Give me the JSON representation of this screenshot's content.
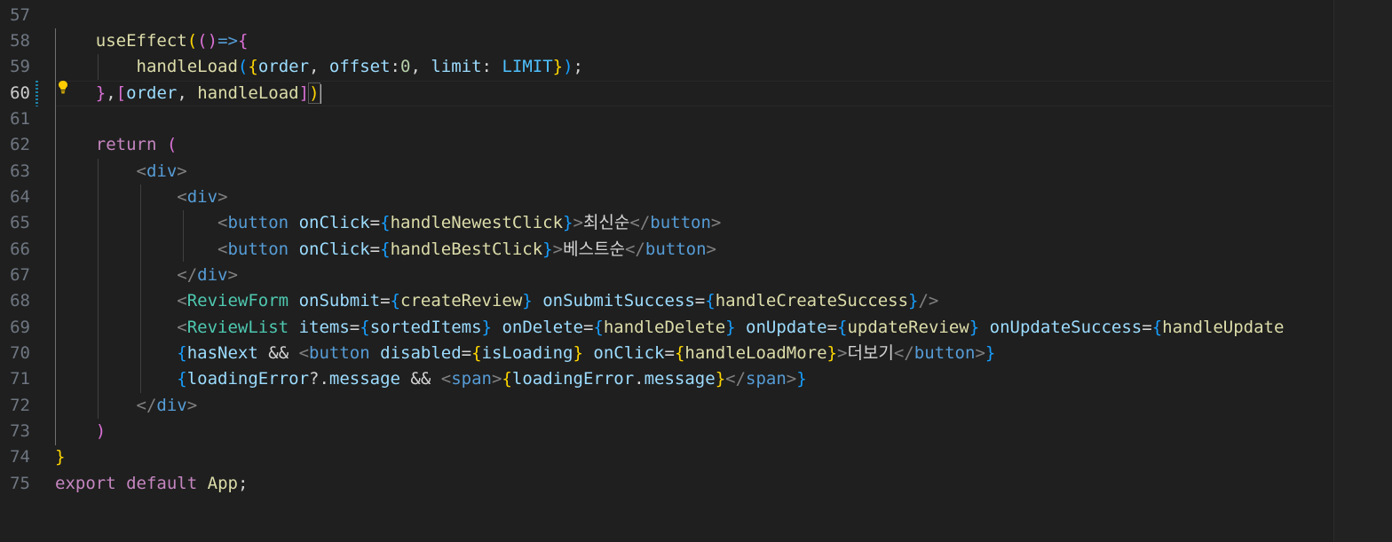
{
  "editor": {
    "active_line": "60",
    "line_numbers": [
      "57",
      "58",
      "59",
      "60",
      "61",
      "62",
      "63",
      "64",
      "65",
      "66",
      "67",
      "68",
      "69",
      "70",
      "71",
      "72",
      "73",
      "74",
      "75"
    ],
    "lines": {
      "l57": [],
      "l58": [
        {
          "t": "    ",
          "c": "txt"
        },
        {
          "t": "useEffect",
          "c": "fn"
        },
        {
          "t": "(",
          "c": "b1"
        },
        {
          "t": "()",
          "c": "b2"
        },
        {
          "t": "=>",
          "c": "tag"
        },
        {
          "t": "{",
          "c": "b2"
        }
      ],
      "l59": [
        {
          "t": "        ",
          "c": "txt"
        },
        {
          "t": "handleLoad",
          "c": "fn"
        },
        {
          "t": "(",
          "c": "b3"
        },
        {
          "t": "{",
          "c": "b1"
        },
        {
          "t": "order",
          "c": "var"
        },
        {
          "t": ", ",
          "c": "txt"
        },
        {
          "t": "offset",
          "c": "var"
        },
        {
          "t": ":",
          "c": "txt"
        },
        {
          "t": "0",
          "c": "num"
        },
        {
          "t": ", ",
          "c": "txt"
        },
        {
          "t": "limit",
          "c": "var"
        },
        {
          "t": ": ",
          "c": "txt"
        },
        {
          "t": "LIMIT",
          "c": "cst"
        },
        {
          "t": "}",
          "c": "b1"
        },
        {
          "t": ")",
          "c": "b3"
        },
        {
          "t": ";",
          "c": "txt"
        }
      ],
      "l60": [
        {
          "t": "    ",
          "c": "txt"
        },
        {
          "t": "}",
          "c": "b2"
        },
        {
          "t": ",",
          "c": "txt"
        },
        {
          "t": "[",
          "c": "b2"
        },
        {
          "t": "order",
          "c": "var"
        },
        {
          "t": ", ",
          "c": "txt"
        },
        {
          "t": "handleLoad",
          "c": "fn"
        },
        {
          "t": "]",
          "c": "b2"
        },
        {
          "t": ")",
          "c": "b1 mb"
        }
      ],
      "l61": [],
      "l62": [
        {
          "t": "    ",
          "c": "txt"
        },
        {
          "t": "return",
          "c": "kw"
        },
        {
          "t": " ",
          "c": "txt"
        },
        {
          "t": "(",
          "c": "b2"
        }
      ],
      "l63": [
        {
          "t": "        ",
          "c": "txt"
        },
        {
          "t": "<",
          "c": "ang"
        },
        {
          "t": "div",
          "c": "tag"
        },
        {
          "t": ">",
          "c": "ang"
        }
      ],
      "l64": [
        {
          "t": "            ",
          "c": "txt"
        },
        {
          "t": "<",
          "c": "ang"
        },
        {
          "t": "div",
          "c": "tag"
        },
        {
          "t": ">",
          "c": "ang"
        }
      ],
      "l65": [
        {
          "t": "                ",
          "c": "txt"
        },
        {
          "t": "<",
          "c": "ang"
        },
        {
          "t": "button",
          "c": "tag"
        },
        {
          "t": " ",
          "c": "txt"
        },
        {
          "t": "onClick",
          "c": "var"
        },
        {
          "t": "=",
          "c": "txt"
        },
        {
          "t": "{",
          "c": "b3"
        },
        {
          "t": "handleNewestClick",
          "c": "fn"
        },
        {
          "t": "}",
          "c": "b3"
        },
        {
          "t": ">",
          "c": "ang"
        },
        {
          "t": "최신순",
          "c": "txt"
        },
        {
          "t": "</",
          "c": "ang"
        },
        {
          "t": "button",
          "c": "tag"
        },
        {
          "t": ">",
          "c": "ang"
        }
      ],
      "l66": [
        {
          "t": "                ",
          "c": "txt"
        },
        {
          "t": "<",
          "c": "ang"
        },
        {
          "t": "button",
          "c": "tag"
        },
        {
          "t": " ",
          "c": "txt"
        },
        {
          "t": "onClick",
          "c": "var"
        },
        {
          "t": "=",
          "c": "txt"
        },
        {
          "t": "{",
          "c": "b3"
        },
        {
          "t": "handleBestClick",
          "c": "fn"
        },
        {
          "t": "}",
          "c": "b3"
        },
        {
          "t": ">",
          "c": "ang"
        },
        {
          "t": "베스트순",
          "c": "txt"
        },
        {
          "t": "</",
          "c": "ang"
        },
        {
          "t": "button",
          "c": "tag"
        },
        {
          "t": ">",
          "c": "ang"
        }
      ],
      "l67": [
        {
          "t": "            ",
          "c": "txt"
        },
        {
          "t": "</",
          "c": "ang"
        },
        {
          "t": "div",
          "c": "tag"
        },
        {
          "t": ">",
          "c": "ang"
        }
      ],
      "l68": [
        {
          "t": "            ",
          "c": "txt"
        },
        {
          "t": "<",
          "c": "ang"
        },
        {
          "t": "ReviewForm",
          "c": "cmp"
        },
        {
          "t": " ",
          "c": "txt"
        },
        {
          "t": "onSubmit",
          "c": "var"
        },
        {
          "t": "=",
          "c": "txt"
        },
        {
          "t": "{",
          "c": "b3"
        },
        {
          "t": "createReview",
          "c": "fn"
        },
        {
          "t": "}",
          "c": "b3"
        },
        {
          "t": " ",
          "c": "txt"
        },
        {
          "t": "onSubmitSuccess",
          "c": "var"
        },
        {
          "t": "=",
          "c": "txt"
        },
        {
          "t": "{",
          "c": "b3"
        },
        {
          "t": "handleCreateSuccess",
          "c": "fn"
        },
        {
          "t": "}",
          "c": "b3"
        },
        {
          "t": "/>",
          "c": "ang"
        }
      ],
      "l69": [
        {
          "t": "            ",
          "c": "txt"
        },
        {
          "t": "<",
          "c": "ang"
        },
        {
          "t": "ReviewList",
          "c": "cmp"
        },
        {
          "t": " ",
          "c": "txt"
        },
        {
          "t": "items",
          "c": "var"
        },
        {
          "t": "=",
          "c": "txt"
        },
        {
          "t": "{",
          "c": "b3"
        },
        {
          "t": "sortedItems",
          "c": "var"
        },
        {
          "t": "}",
          "c": "b3"
        },
        {
          "t": " ",
          "c": "txt"
        },
        {
          "t": "onDelete",
          "c": "var"
        },
        {
          "t": "=",
          "c": "txt"
        },
        {
          "t": "{",
          "c": "b3"
        },
        {
          "t": "handleDelete",
          "c": "fn"
        },
        {
          "t": "}",
          "c": "b3"
        },
        {
          "t": " ",
          "c": "txt"
        },
        {
          "t": "onUpdate",
          "c": "var"
        },
        {
          "t": "=",
          "c": "txt"
        },
        {
          "t": "{",
          "c": "b3"
        },
        {
          "t": "updateReview",
          "c": "fn"
        },
        {
          "t": "}",
          "c": "b3"
        },
        {
          "t": " ",
          "c": "txt"
        },
        {
          "t": "onUpdateSuccess",
          "c": "var"
        },
        {
          "t": "=",
          "c": "txt"
        },
        {
          "t": "{",
          "c": "b3"
        },
        {
          "t": "handleUpdate",
          "c": "fn"
        }
      ],
      "l70": [
        {
          "t": "            ",
          "c": "txt"
        },
        {
          "t": "{",
          "c": "b3"
        },
        {
          "t": "hasNext",
          "c": "var"
        },
        {
          "t": " && ",
          "c": "txt"
        },
        {
          "t": "<",
          "c": "ang"
        },
        {
          "t": "button",
          "c": "tag"
        },
        {
          "t": " ",
          "c": "txt"
        },
        {
          "t": "disabled",
          "c": "var"
        },
        {
          "t": "=",
          "c": "txt"
        },
        {
          "t": "{",
          "c": "b1"
        },
        {
          "t": "isLoading",
          "c": "var"
        },
        {
          "t": "}",
          "c": "b1"
        },
        {
          "t": " ",
          "c": "txt"
        },
        {
          "t": "onClick",
          "c": "var"
        },
        {
          "t": "=",
          "c": "txt"
        },
        {
          "t": "{",
          "c": "b1"
        },
        {
          "t": "handleLoadMore",
          "c": "fn"
        },
        {
          "t": "}",
          "c": "b1"
        },
        {
          "t": ">",
          "c": "ang"
        },
        {
          "t": "더보기",
          "c": "txt"
        },
        {
          "t": "</",
          "c": "ang"
        },
        {
          "t": "button",
          "c": "tag"
        },
        {
          "t": ">",
          "c": "ang"
        },
        {
          "t": "}",
          "c": "b3"
        }
      ],
      "l71": [
        {
          "t": "            ",
          "c": "txt"
        },
        {
          "t": "{",
          "c": "b3"
        },
        {
          "t": "loadingError",
          "c": "var"
        },
        {
          "t": "?.",
          "c": "txt"
        },
        {
          "t": "message",
          "c": "var"
        },
        {
          "t": " && ",
          "c": "txt"
        },
        {
          "t": "<",
          "c": "ang"
        },
        {
          "t": "span",
          "c": "tag"
        },
        {
          "t": ">",
          "c": "ang"
        },
        {
          "t": "{",
          "c": "b1"
        },
        {
          "t": "loadingError",
          "c": "var"
        },
        {
          "t": ".",
          "c": "txt"
        },
        {
          "t": "message",
          "c": "var"
        },
        {
          "t": "}",
          "c": "b1"
        },
        {
          "t": "</",
          "c": "ang"
        },
        {
          "t": "span",
          "c": "tag"
        },
        {
          "t": ">",
          "c": "ang"
        },
        {
          "t": "}",
          "c": "b3"
        }
      ],
      "l72": [
        {
          "t": "        ",
          "c": "txt"
        },
        {
          "t": "</",
          "c": "ang"
        },
        {
          "t": "div",
          "c": "tag"
        },
        {
          "t": ">",
          "c": "ang"
        }
      ],
      "l73": [
        {
          "t": "    ",
          "c": "txt"
        },
        {
          "t": ")",
          "c": "b2"
        }
      ],
      "l74": [
        {
          "t": "}",
          "c": "b1"
        }
      ],
      "l75": [
        {
          "t": "export",
          "c": "kw"
        },
        {
          "t": " ",
          "c": "txt"
        },
        {
          "t": "default",
          "c": "kw"
        },
        {
          "t": " ",
          "c": "txt"
        },
        {
          "t": "App",
          "c": "fn"
        },
        {
          "t": ";",
          "c": "txt"
        }
      ]
    }
  }
}
